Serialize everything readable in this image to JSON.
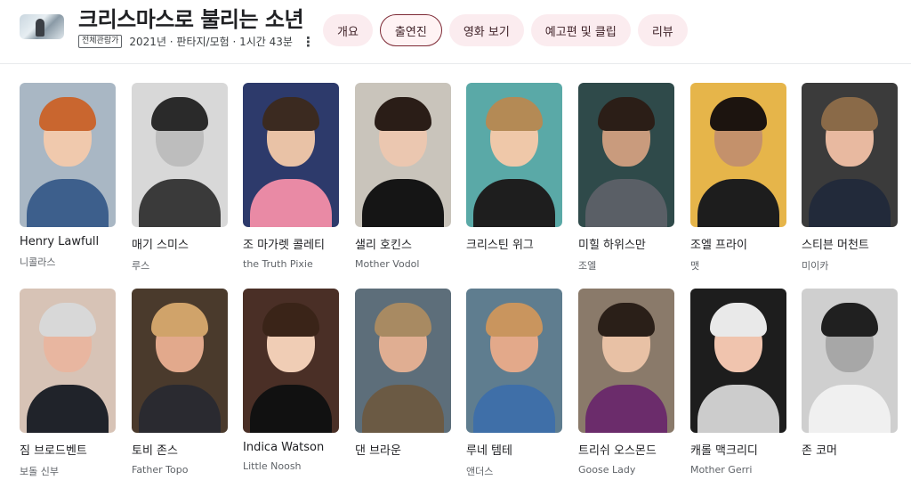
{
  "movie": {
    "title": "크리스마스로 불리는 소년",
    "rating_badge": "전체관람가",
    "meta": "2021년 · 판타지/모험 · 1시간 43분",
    "more_icon": "⋮"
  },
  "tabs": [
    {
      "label": "개요",
      "active": false
    },
    {
      "label": "출연진",
      "active": true
    },
    {
      "label": "영화 보기",
      "active": false
    },
    {
      "label": "예고편 및 클립",
      "active": false
    },
    {
      "label": "리뷰",
      "active": false
    }
  ],
  "cast": [
    {
      "name": "Henry Lawfull",
      "role": "니콜라스",
      "bg": "#a9b7c4",
      "skin": "#f0c9ad",
      "hair": "#c9662f",
      "cloth": "#3d5f8c"
    },
    {
      "name": "매기 스미스",
      "role": "루스",
      "bg": "#d8d8d8",
      "skin": "#bdbdbd",
      "hair": "#2a2a2a",
      "cloth": "#3a3a3a"
    },
    {
      "name": "조 마가렛 콜레티",
      "role": "the Truth Pixie",
      "bg": "#2d3a6b",
      "skin": "#e9c2a6",
      "hair": "#3b2a20",
      "cloth": "#e98aa5"
    },
    {
      "name": "샐리 호킨스",
      "role": "Mother Vodol",
      "bg": "#c9c4bb",
      "skin": "#ebc7b0",
      "hair": "#2a1d17",
      "cloth": "#151515"
    },
    {
      "name": "크리스틴 위그",
      "role": "",
      "bg": "#5aa9a7",
      "skin": "#efc8a9",
      "hair": "#b48a55",
      "cloth": "#1e1e1e"
    },
    {
      "name": "미힐 하위스만",
      "role": "조엘",
      "bg": "#2f4a4a",
      "skin": "#c99b7d",
      "hair": "#2b1e17",
      "cloth": "#5a5f66"
    },
    {
      "name": "조엘 프라이",
      "role": "맷",
      "bg": "#e6b54a",
      "skin": "#c4916b",
      "hair": "#1c140f",
      "cloth": "#1d1d1d"
    },
    {
      "name": "스티븐 머천트",
      "role": "미이카",
      "bg": "#3b3b3b",
      "skin": "#e8b9a0",
      "hair": "#8a6a48",
      "cloth": "#222a3a"
    },
    {
      "name": "짐 브로드벤트",
      "role": "보돌 신부",
      "bg": "#d7c3b6",
      "skin": "#e8b6a0",
      "hair": "#d8d8d8",
      "cloth": "#20232a"
    },
    {
      "name": "토비 존스",
      "role": "Father Topo",
      "bg": "#4a3a2c",
      "skin": "#e2a98c",
      "hair": "#d0a36a",
      "cloth": "#2a2a30"
    },
    {
      "name": "Indica Watson",
      "role": "Little Noosh",
      "bg": "#4a2f26",
      "skin": "#f0cdb5",
      "hair": "#3a2418",
      "cloth": "#111111"
    },
    {
      "name": "댄 브라운",
      "role": "",
      "bg": "#5d6e7a",
      "skin": "#e0ae92",
      "hair": "#a88a62",
      "cloth": "#6b5a44"
    },
    {
      "name": "루네 템테",
      "role": "앤더스",
      "bg": "#5f7d8f",
      "skin": "#e3a98a",
      "hair": "#c9955e",
      "cloth": "#3f6fa8"
    },
    {
      "name": "트리쉬 오스몬드",
      "role": "Goose Lady",
      "bg": "#8a7a6a",
      "skin": "#e8c1a5",
      "hair": "#2a1f18",
      "cloth": "#6b2c6b"
    },
    {
      "name": "캐롤 맥크리디",
      "role": "Mother Gerri",
      "bg": "#1d1d1d",
      "skin": "#f0c4ae",
      "hair": "#e9e9e9",
      "cloth": "#cccccc"
    },
    {
      "name": "존 코머",
      "role": "",
      "bg": "#cfcfcf",
      "skin": "#a7a7a7",
      "hair": "#202020",
      "cloth": "#f0f0f0"
    }
  ]
}
